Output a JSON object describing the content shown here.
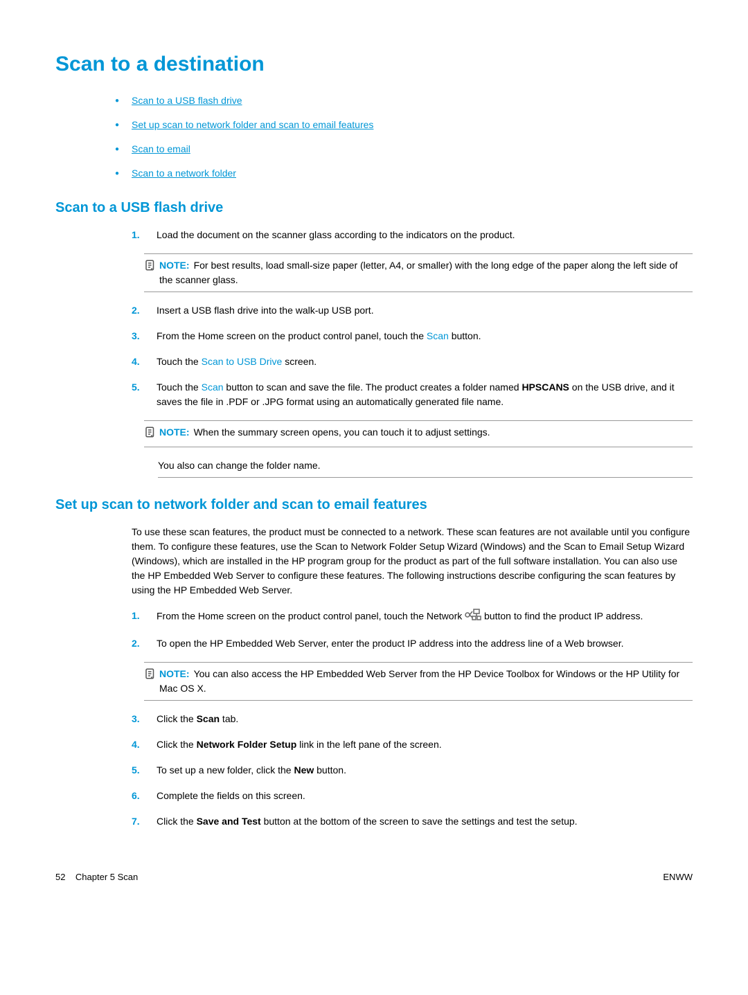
{
  "title": "Scan to a destination",
  "toc": [
    "Scan to a USB flash drive",
    "Set up scan to network folder and scan to email features",
    "Scan to email",
    "Scan to a network folder"
  ],
  "section1": {
    "heading": "Scan to a USB flash drive",
    "steps": {
      "s1": {
        "num": "1.",
        "text": "Load the document on the scanner glass according to the indicators on the product."
      },
      "note1": {
        "label": "NOTE:",
        "text": "For best results, load small-size paper (letter, A4, or smaller) with the long edge of the paper along the left side of the scanner glass."
      },
      "s2": {
        "num": "2.",
        "text": "Insert a USB flash drive into the walk-up USB port."
      },
      "s3": {
        "num": "3.",
        "pre": "From the Home screen on the product control panel, touch the ",
        "scan": "Scan",
        "post": " button."
      },
      "s4": {
        "num": "4.",
        "pre": "Touch the ",
        "scan": "Scan to USB Drive",
        "post": " screen."
      },
      "s5": {
        "num": "5.",
        "pre": "Touch the ",
        "scan": "Scan",
        "mid": " button to scan and save the file. The product creates a folder named ",
        "bold": "HPSCANS",
        "post": " on the USB drive, and it saves the file in .PDF or .JPG format using an automatically generated file name."
      },
      "note2": {
        "label": "NOTE:",
        "text": "When the summary screen opens, you can touch it to adjust settings."
      },
      "extra": "You also can change the folder name."
    }
  },
  "section2": {
    "heading": "Set up scan to network folder and scan to email features",
    "intro": "To use these scan features, the product must be connected to a network. These scan features are not available until you configure them. To configure these features, use the Scan to Network Folder Setup Wizard (Windows) and the Scan to Email Setup Wizard (Windows), which are installed in the HP program group for the product as part of the full software installation. You can also use the HP Embedded Web Server to configure these features. The following instructions describe configuring the scan features by using the HP Embedded Web Server.",
    "steps": {
      "s1": {
        "num": "1.",
        "pre": "From the Home screen on the product control panel, touch the Network ",
        "post": " button to find the product IP address."
      },
      "s2": {
        "num": "2.",
        "text": "To open the HP Embedded Web Server, enter the product IP address into the address line of a Web browser."
      },
      "note1": {
        "label": "NOTE:",
        "text": "You can also access the HP Embedded Web Server from the HP Device Toolbox for Windows or the HP Utility for Mac OS X."
      },
      "s3": {
        "num": "3.",
        "pre": "Click the ",
        "bold": "Scan",
        "post": " tab."
      },
      "s4": {
        "num": "4.",
        "pre": "Click the ",
        "bold": "Network Folder Setup",
        "post": " link in the left pane of the screen."
      },
      "s5": {
        "num": "5.",
        "pre": "To set up a new folder, click the ",
        "bold": "New",
        "post": " button."
      },
      "s6": {
        "num": "6.",
        "text": "Complete the fields on this screen."
      },
      "s7": {
        "num": "7.",
        "pre": "Click the ",
        "bold": "Save and Test",
        "post": " button at the bottom of the screen to save the settings and test the setup."
      }
    }
  },
  "footer": {
    "left_page": "52",
    "left_text": "Chapter 5   Scan",
    "right": "ENWW"
  }
}
